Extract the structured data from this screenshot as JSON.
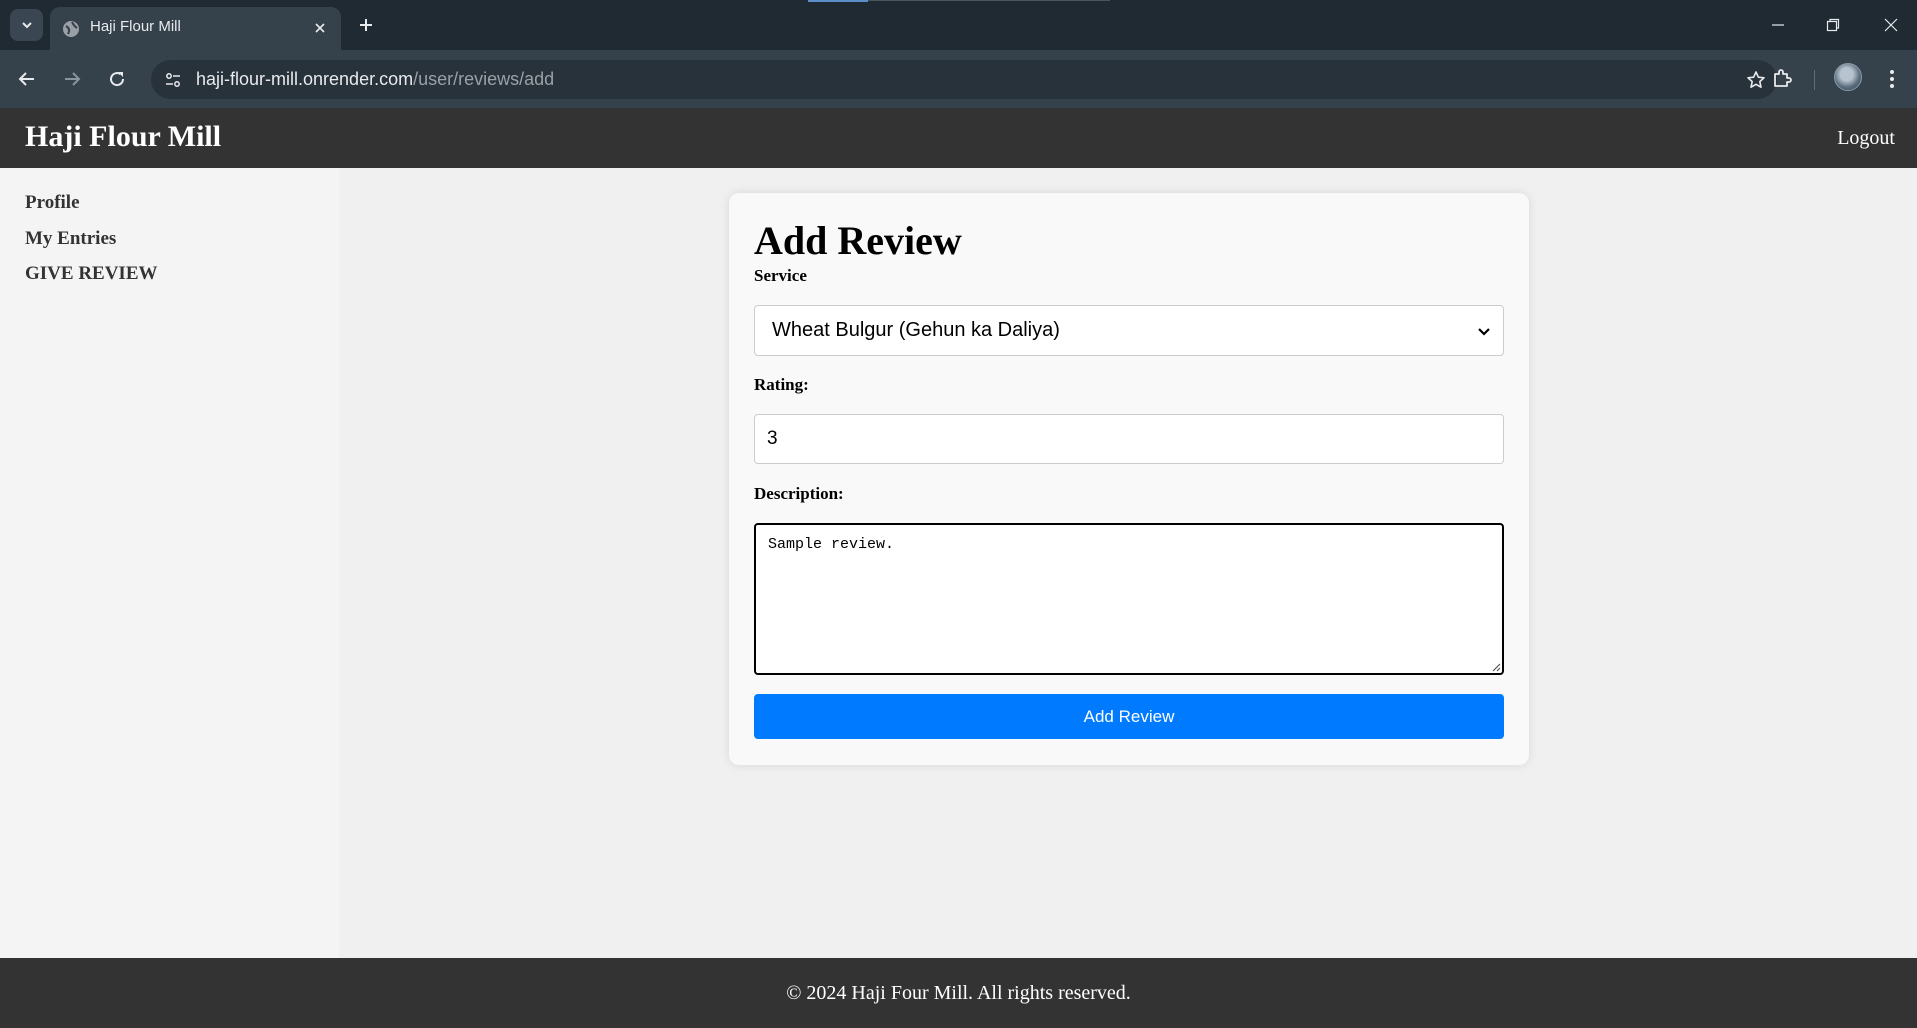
{
  "browser": {
    "tab_title": "Haji Flour Mill",
    "url_host": "haji-flour-mill.onrender.com",
    "url_path": "/user/reviews/add"
  },
  "header": {
    "brand": "Haji Flour Mill",
    "logout_label": "Logout"
  },
  "sidebar": {
    "items": [
      {
        "label": "Profile"
      },
      {
        "label": "My Entries"
      },
      {
        "label": "GIVE REVIEW"
      }
    ]
  },
  "form": {
    "title": "Add Review",
    "service_label": "Service",
    "service_value": "Wheat Bulgur (Gehun ka Daliya)",
    "rating_label": "Rating:",
    "rating_value": "3",
    "description_label": "Description:",
    "description_value": "Sample review.",
    "submit_label": "Add Review"
  },
  "footer": {
    "copyright": "© 2024 Haji Four Mill. All rights reserved."
  },
  "colors": {
    "header_bg": "#333333",
    "accent": "#007bff",
    "card_bg": "#f9f9f9"
  }
}
